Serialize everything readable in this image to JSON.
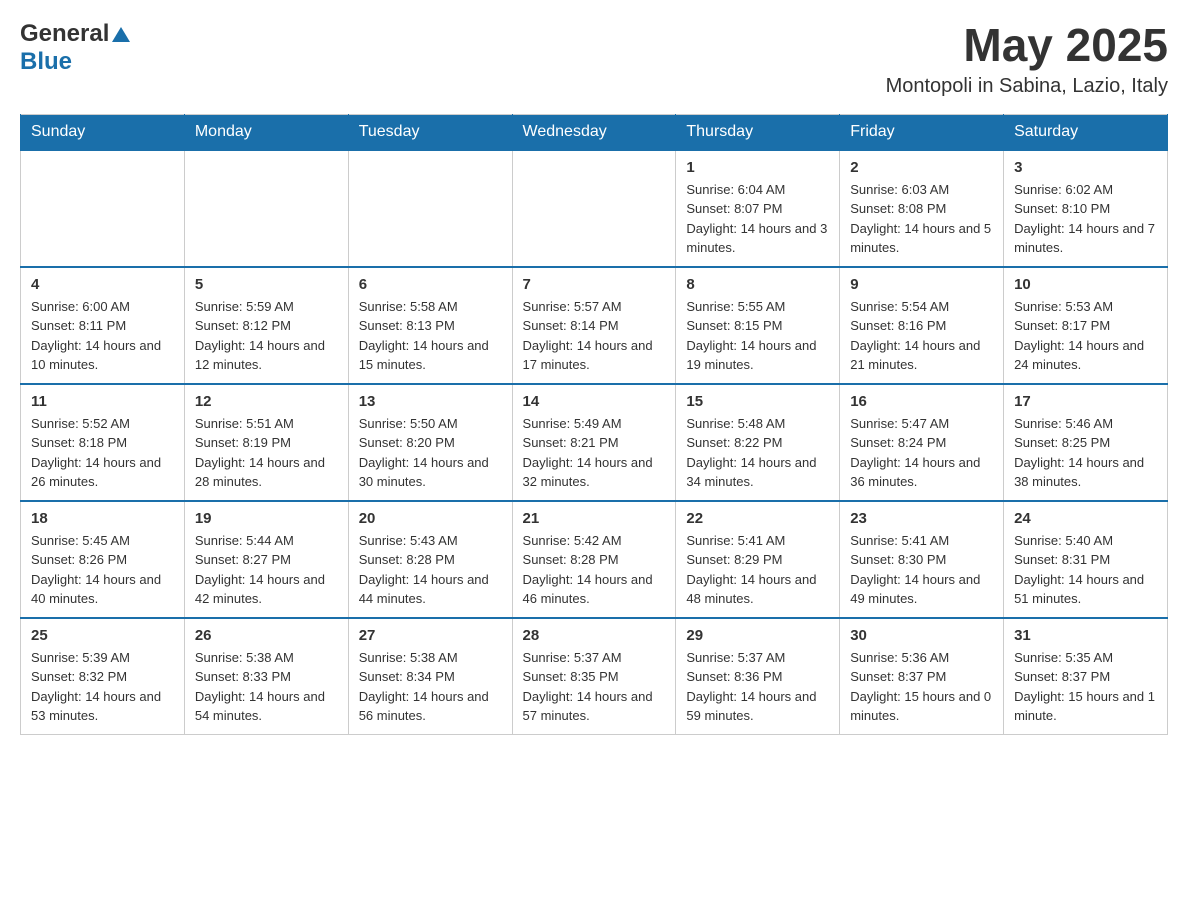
{
  "header": {
    "logo_general": "General",
    "logo_blue": "Blue",
    "month_year": "May 2025",
    "location": "Montopoli in Sabina, Lazio, Italy"
  },
  "days_of_week": [
    "Sunday",
    "Monday",
    "Tuesday",
    "Wednesday",
    "Thursday",
    "Friday",
    "Saturday"
  ],
  "weeks": [
    [
      {
        "day": "",
        "info": ""
      },
      {
        "day": "",
        "info": ""
      },
      {
        "day": "",
        "info": ""
      },
      {
        "day": "",
        "info": ""
      },
      {
        "day": "1",
        "info": "Sunrise: 6:04 AM\nSunset: 8:07 PM\nDaylight: 14 hours and 3 minutes."
      },
      {
        "day": "2",
        "info": "Sunrise: 6:03 AM\nSunset: 8:08 PM\nDaylight: 14 hours and 5 minutes."
      },
      {
        "day": "3",
        "info": "Sunrise: 6:02 AM\nSunset: 8:10 PM\nDaylight: 14 hours and 7 minutes."
      }
    ],
    [
      {
        "day": "4",
        "info": "Sunrise: 6:00 AM\nSunset: 8:11 PM\nDaylight: 14 hours and 10 minutes."
      },
      {
        "day": "5",
        "info": "Sunrise: 5:59 AM\nSunset: 8:12 PM\nDaylight: 14 hours and 12 minutes."
      },
      {
        "day": "6",
        "info": "Sunrise: 5:58 AM\nSunset: 8:13 PM\nDaylight: 14 hours and 15 minutes."
      },
      {
        "day": "7",
        "info": "Sunrise: 5:57 AM\nSunset: 8:14 PM\nDaylight: 14 hours and 17 minutes."
      },
      {
        "day": "8",
        "info": "Sunrise: 5:55 AM\nSunset: 8:15 PM\nDaylight: 14 hours and 19 minutes."
      },
      {
        "day": "9",
        "info": "Sunrise: 5:54 AM\nSunset: 8:16 PM\nDaylight: 14 hours and 21 minutes."
      },
      {
        "day": "10",
        "info": "Sunrise: 5:53 AM\nSunset: 8:17 PM\nDaylight: 14 hours and 24 minutes."
      }
    ],
    [
      {
        "day": "11",
        "info": "Sunrise: 5:52 AM\nSunset: 8:18 PM\nDaylight: 14 hours and 26 minutes."
      },
      {
        "day": "12",
        "info": "Sunrise: 5:51 AM\nSunset: 8:19 PM\nDaylight: 14 hours and 28 minutes."
      },
      {
        "day": "13",
        "info": "Sunrise: 5:50 AM\nSunset: 8:20 PM\nDaylight: 14 hours and 30 minutes."
      },
      {
        "day": "14",
        "info": "Sunrise: 5:49 AM\nSunset: 8:21 PM\nDaylight: 14 hours and 32 minutes."
      },
      {
        "day": "15",
        "info": "Sunrise: 5:48 AM\nSunset: 8:22 PM\nDaylight: 14 hours and 34 minutes."
      },
      {
        "day": "16",
        "info": "Sunrise: 5:47 AM\nSunset: 8:24 PM\nDaylight: 14 hours and 36 minutes."
      },
      {
        "day": "17",
        "info": "Sunrise: 5:46 AM\nSunset: 8:25 PM\nDaylight: 14 hours and 38 minutes."
      }
    ],
    [
      {
        "day": "18",
        "info": "Sunrise: 5:45 AM\nSunset: 8:26 PM\nDaylight: 14 hours and 40 minutes."
      },
      {
        "day": "19",
        "info": "Sunrise: 5:44 AM\nSunset: 8:27 PM\nDaylight: 14 hours and 42 minutes."
      },
      {
        "day": "20",
        "info": "Sunrise: 5:43 AM\nSunset: 8:28 PM\nDaylight: 14 hours and 44 minutes."
      },
      {
        "day": "21",
        "info": "Sunrise: 5:42 AM\nSunset: 8:28 PM\nDaylight: 14 hours and 46 minutes."
      },
      {
        "day": "22",
        "info": "Sunrise: 5:41 AM\nSunset: 8:29 PM\nDaylight: 14 hours and 48 minutes."
      },
      {
        "day": "23",
        "info": "Sunrise: 5:41 AM\nSunset: 8:30 PM\nDaylight: 14 hours and 49 minutes."
      },
      {
        "day": "24",
        "info": "Sunrise: 5:40 AM\nSunset: 8:31 PM\nDaylight: 14 hours and 51 minutes."
      }
    ],
    [
      {
        "day": "25",
        "info": "Sunrise: 5:39 AM\nSunset: 8:32 PM\nDaylight: 14 hours and 53 minutes."
      },
      {
        "day": "26",
        "info": "Sunrise: 5:38 AM\nSunset: 8:33 PM\nDaylight: 14 hours and 54 minutes."
      },
      {
        "day": "27",
        "info": "Sunrise: 5:38 AM\nSunset: 8:34 PM\nDaylight: 14 hours and 56 minutes."
      },
      {
        "day": "28",
        "info": "Sunrise: 5:37 AM\nSunset: 8:35 PM\nDaylight: 14 hours and 57 minutes."
      },
      {
        "day": "29",
        "info": "Sunrise: 5:37 AM\nSunset: 8:36 PM\nDaylight: 14 hours and 59 minutes."
      },
      {
        "day": "30",
        "info": "Sunrise: 5:36 AM\nSunset: 8:37 PM\nDaylight: 15 hours and 0 minutes."
      },
      {
        "day": "31",
        "info": "Sunrise: 5:35 AM\nSunset: 8:37 PM\nDaylight: 15 hours and 1 minute."
      }
    ]
  ]
}
